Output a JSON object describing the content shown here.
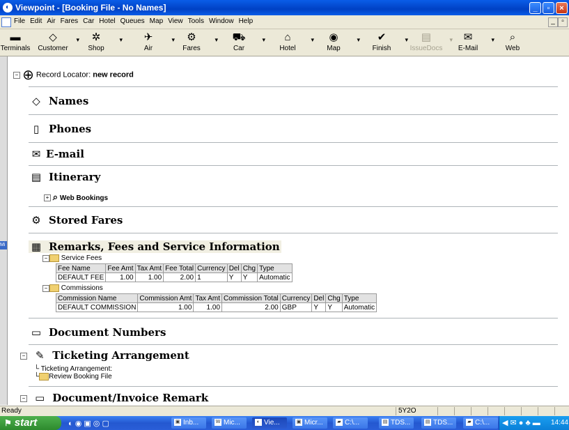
{
  "window": {
    "title": "Viewpoint - [Booking File - No Names]"
  },
  "menu": [
    "File",
    "Edit",
    "Air",
    "Fares",
    "Car",
    "Hotel",
    "Queues",
    "Map",
    "View",
    "Tools",
    "Window",
    "Help"
  ],
  "toolbar": [
    {
      "label": "Terminals",
      "icon": "terminal-icon",
      "glyph": "▬",
      "disabled": false
    },
    {
      "label": "Customer",
      "icon": "tag-icon",
      "glyph": "◇",
      "disabled": false
    },
    {
      "label": "Shop",
      "icon": "shop-icon",
      "glyph": "✲",
      "disabled": false
    },
    {
      "label": "Air",
      "icon": "airplane-icon",
      "glyph": "✈",
      "disabled": false
    },
    {
      "label": "Fares",
      "icon": "fares-icon",
      "glyph": "⚙",
      "disabled": false
    },
    {
      "label": "Car",
      "icon": "car-icon",
      "glyph": "⛟",
      "disabled": false
    },
    {
      "label": "Hotel",
      "icon": "hotel-icon",
      "glyph": "⌂",
      "disabled": false
    },
    {
      "label": "Map",
      "icon": "globe-icon",
      "glyph": "◉",
      "disabled": false
    },
    {
      "label": "Finish",
      "icon": "finish-icon",
      "glyph": "✔",
      "disabled": false
    },
    {
      "label": "IssueDocs",
      "icon": "document-icon",
      "glyph": "▤",
      "disabled": true
    },
    {
      "label": "E-Mail",
      "icon": "email-icon",
      "glyph": "✉",
      "disabled": false
    },
    {
      "label": "Web",
      "icon": "web-icon",
      "glyph": "⌕",
      "disabled": false
    }
  ],
  "record": {
    "label": "Record Locator:",
    "value": "new record"
  },
  "sections": {
    "names": "Names",
    "phones": "Phones",
    "email": "E-mail",
    "itinerary": "Itinerary",
    "web_bookings": "Web Bookings",
    "stored_fares": "Stored Fares",
    "remarks": "Remarks, Fees and Service Information",
    "document_numbers": "Document Numbers",
    "ticketing": "Ticketing Arrangement",
    "ticketing_sub1": "Ticketing Arrangement:",
    "ticketing_sub2": "Review Booking File",
    "doc_invoice": "Document/Invoice Remark"
  },
  "service_fees": {
    "label": "Service Fees",
    "headers": [
      "Fee Name",
      "Fee Amt",
      "Tax Amt",
      "Fee Total",
      "Currency",
      "Del",
      "Chg",
      "Type"
    ],
    "rows": [
      [
        "DEFAULT FEE",
        "1.00",
        "1.00",
        "2.00",
        "1",
        "Y",
        "Y",
        "Automatic"
      ]
    ]
  },
  "commissions": {
    "label": "Commissions",
    "headers": [
      "Commission Name",
      "Commission Amt",
      "Tax Amt",
      "Commission Total",
      "Currency",
      "Del",
      "Chg",
      "Type"
    ],
    "rows": [
      [
        "DEFAULT COMMISSION",
        "1.00",
        "1.00",
        "2.00",
        "GBP",
        "Y",
        "Y",
        "Automatic"
      ]
    ]
  },
  "status": {
    "text": "Ready",
    "code": "5Y2O"
  },
  "taskbar": {
    "start": "start",
    "tasks": [
      "Inb...",
      "Mic...",
      "Vie...",
      "Micr...",
      "C:\\...",
      "TDS...",
      "TDS...",
      "C:\\..."
    ],
    "clock": "14:44"
  },
  "colors": {
    "titlebar": "#0a5de8",
    "taskbar": "#2458d0",
    "start": "#3c9c3c"
  }
}
